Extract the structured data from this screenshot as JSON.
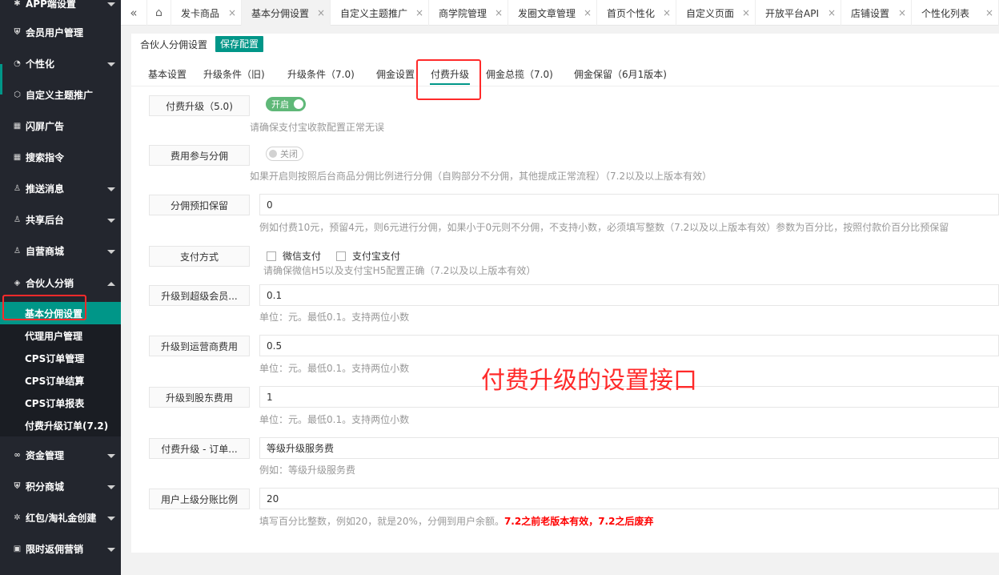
{
  "sidebar": {
    "items": [
      {
        "label": "APP端设置",
        "icon": "gear-icon"
      },
      {
        "label": "会员用户管理",
        "icon": "shield-icon"
      },
      {
        "label": "个性化",
        "icon": "palette-icon"
      },
      {
        "label": "自定义主题推广",
        "icon": "cube-icon"
      },
      {
        "label": "闪屏广告",
        "icon": "grid-icon"
      },
      {
        "label": "搜索指令",
        "icon": "grid-icon"
      },
      {
        "label": "推送消息",
        "icon": "user-icon"
      },
      {
        "label": "共享后台",
        "icon": "user-icon"
      },
      {
        "label": "自营商城",
        "icon": "user-icon"
      },
      {
        "label": "合伙人分销",
        "icon": "layers-icon"
      },
      {
        "label": "资金管理",
        "icon": "link-icon"
      },
      {
        "label": "积分商城",
        "icon": "shield-icon"
      },
      {
        "label": "红包/淘礼金创建",
        "icon": "gear-icon"
      },
      {
        "label": "限时返佣营销",
        "icon": "calendar-icon"
      }
    ],
    "subitems": [
      {
        "label": "基本分佣设置"
      },
      {
        "label": "代理用户管理"
      },
      {
        "label": "CPS订单管理"
      },
      {
        "label": "CPS订单结算"
      },
      {
        "label": "CPS订单报表"
      },
      {
        "label": "付费升级订单(7.2)"
      }
    ]
  },
  "tabs": [
    {
      "label": "发卡商品"
    },
    {
      "label": "基本分佣设置"
    },
    {
      "label": "自定义主题推广"
    },
    {
      "label": "商学院管理"
    },
    {
      "label": "发圈文章管理"
    },
    {
      "label": "首页个性化"
    },
    {
      "label": "自定义页面"
    },
    {
      "label": "开放平台API"
    },
    {
      "label": "店铺设置"
    },
    {
      "label": "个性化列表"
    }
  ],
  "header": {
    "title": "合伙人分佣设置",
    "save_label": "保存配置"
  },
  "subtabs": [
    {
      "label": "基本设置"
    },
    {
      "label": "升级条件（旧)"
    },
    {
      "label": "升级条件（7.0)"
    },
    {
      "label": "佣金设置"
    },
    {
      "label": "付费升级"
    },
    {
      "label": "佣金总揽（7.0)"
    },
    {
      "label": "佣金保留（6月1版本)"
    }
  ],
  "form": {
    "paid_upgrade": {
      "label": "付费升级（5.0)",
      "switch": "开启",
      "hint": "请确保支付宝收款配置正常无误"
    },
    "fee_commission": {
      "label": "费用参与分佣",
      "switch": "关闭",
      "hint": "如果开启则按照后台商品分佣比例进行分佣（自购部分不分佣，其他提成正常流程）（7.2以及以上版本有效）"
    },
    "reserve": {
      "label": "分佣预扣保留",
      "value": "0",
      "hint": "例如付费10元，预留4元，则6元进行分佣，如果小于0元则不分佣，不支持小数，必须填写整数（7.2以及以上版本有效）参数为百分比，按照付款价百分比预保留"
    },
    "payment": {
      "label": "支付方式",
      "wechat": "微信支付",
      "alipay": "支付宝支付",
      "hint": "请确保微信H5以及支付宝H5配置正确（7.2以及以上版本有效）"
    },
    "super_member": {
      "label": "升级到超级会员...",
      "value": "0.1",
      "hint": "单位：元。最低0.1。支持两位小数"
    },
    "operator": {
      "label": "升级到运营商费用",
      "value": "0.5",
      "hint": "单位：元。最低0.1。支持两位小数"
    },
    "shareholder": {
      "label": "升级到股东费用",
      "value": "1",
      "hint": "单位：元。最低0.1。支持两位小数"
    },
    "order": {
      "label": "付费升级 - 订单...",
      "value": "等级升级服务费",
      "hint": "例如：等级升级服务费"
    },
    "ratio": {
      "label": "用户上级分账比例",
      "value": "20",
      "hint": "填写百分比整数，例如20，就是20%，分佣到用户余额。",
      "hint_red": "7.2之前老版本有效，7.2之后废弃"
    }
  },
  "annotation": "付费升级的设置接口",
  "colors": {
    "accent": "#009688",
    "sidebar": "#23262e",
    "switch_on": "#5fb878",
    "highlight": "#ff2a2a"
  }
}
